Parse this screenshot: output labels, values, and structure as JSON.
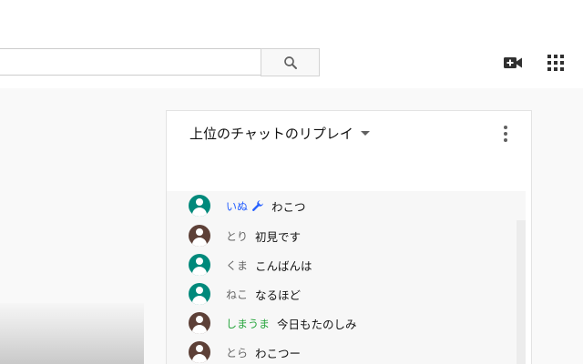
{
  "header": {
    "search": {
      "value": "",
      "placeholder": ""
    },
    "icons": {
      "search": "search-icon",
      "create_video": "video-plus-icon",
      "apps": "apps-grid-icon"
    }
  },
  "chat": {
    "title": "上位のチャットのリプレイ",
    "dropdown_icon": "caret-down-icon",
    "menu_icon": "more-vert-icon",
    "messages": [
      {
        "author": "いぬ",
        "text": "わこつ",
        "author_color": "#2962ff",
        "badge": "wrench-icon",
        "avatar_color": "#00897b"
      },
      {
        "author": "とり",
        "text": "初見です",
        "author_color": "#666666",
        "avatar_color": "#5d4037"
      },
      {
        "author": "くま",
        "text": "こんばんは",
        "author_color": "#666666",
        "avatar_color": "#00897b"
      },
      {
        "author": "ねこ",
        "text": "なるほど",
        "author_color": "#666666",
        "avatar_color": "#00897b"
      },
      {
        "author": "しまうま",
        "text": "今日もたのしみ",
        "author_color": "#2ba640",
        "avatar_color": "#5d4037"
      },
      {
        "author": "とら",
        "text": "わこつー",
        "author_color": "#666666",
        "avatar_color": "#5d4037"
      }
    ]
  },
  "colors": {
    "moderator_name": "#2962ff",
    "member_name": "#2ba640",
    "avatar_teal": "#00897b",
    "avatar_brown": "#5d4037"
  }
}
